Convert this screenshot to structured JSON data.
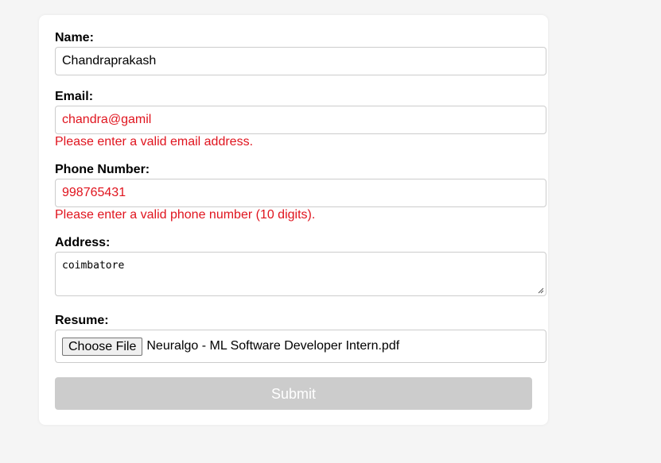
{
  "form": {
    "name": {
      "label": "Name:",
      "value": "Chandraprakash"
    },
    "email": {
      "label": "Email:",
      "value": "chandra@gamil",
      "error": "Please enter a valid email address."
    },
    "phone": {
      "label": "Phone Number:",
      "value": "998765431",
      "error": "Please enter a valid phone number (10 digits)."
    },
    "address": {
      "label": "Address:",
      "value": "coimbatore"
    },
    "resume": {
      "label": "Resume:",
      "button_label": "Choose File",
      "file_name": "Neuralgo - ML Software Developer Intern.pdf"
    },
    "submit_label": "Submit"
  },
  "colors": {
    "error": "#e0141e",
    "submit_disabled_bg": "#cccccc",
    "page_bg": "#f5f5f5"
  }
}
